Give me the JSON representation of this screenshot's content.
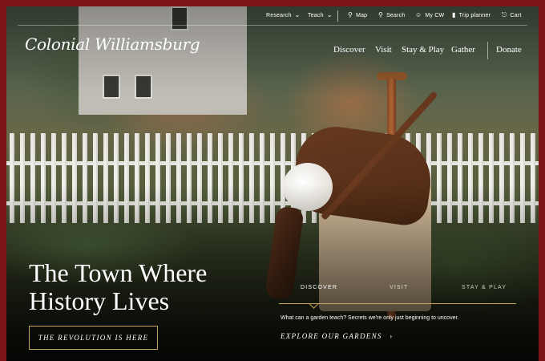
{
  "brand": {
    "logo_text": "Colonial Williamsburg"
  },
  "utility_nav": {
    "research": "Research",
    "teach": "Teach",
    "map": "Map",
    "search": "Search",
    "my_cw": "My CW",
    "trip_planner": "Trip planner",
    "cart": "Cart",
    "icons": {
      "map": "map-pin-icon",
      "search": "search-icon",
      "my_cw": "user-icon",
      "trip_planner": "bookmark-icon",
      "cart": "cart-icon",
      "dropdown": "chevron-down-icon"
    }
  },
  "main_nav": {
    "discover": "Discover",
    "visit": "Visit",
    "stay_play": "Stay & Play",
    "gather": "Gather",
    "donate": "Donate"
  },
  "hero": {
    "headline_line1": "The Town Where",
    "headline_line2": "History Lives",
    "cta_label": "THE REVOLUTION IS HERE"
  },
  "tabs": {
    "items": [
      "DISCOVER",
      "VISIT",
      "STAY & PLAY"
    ],
    "active": "DISCOVER",
    "description": "What can a garden teach? Secrets we're only just beginning to uncover.",
    "link_label": "EXPLORE OUR GARDENS",
    "link_arrow": "›"
  },
  "colors": {
    "frame": "#7a1418",
    "accent_gold": "#c8a45a"
  }
}
